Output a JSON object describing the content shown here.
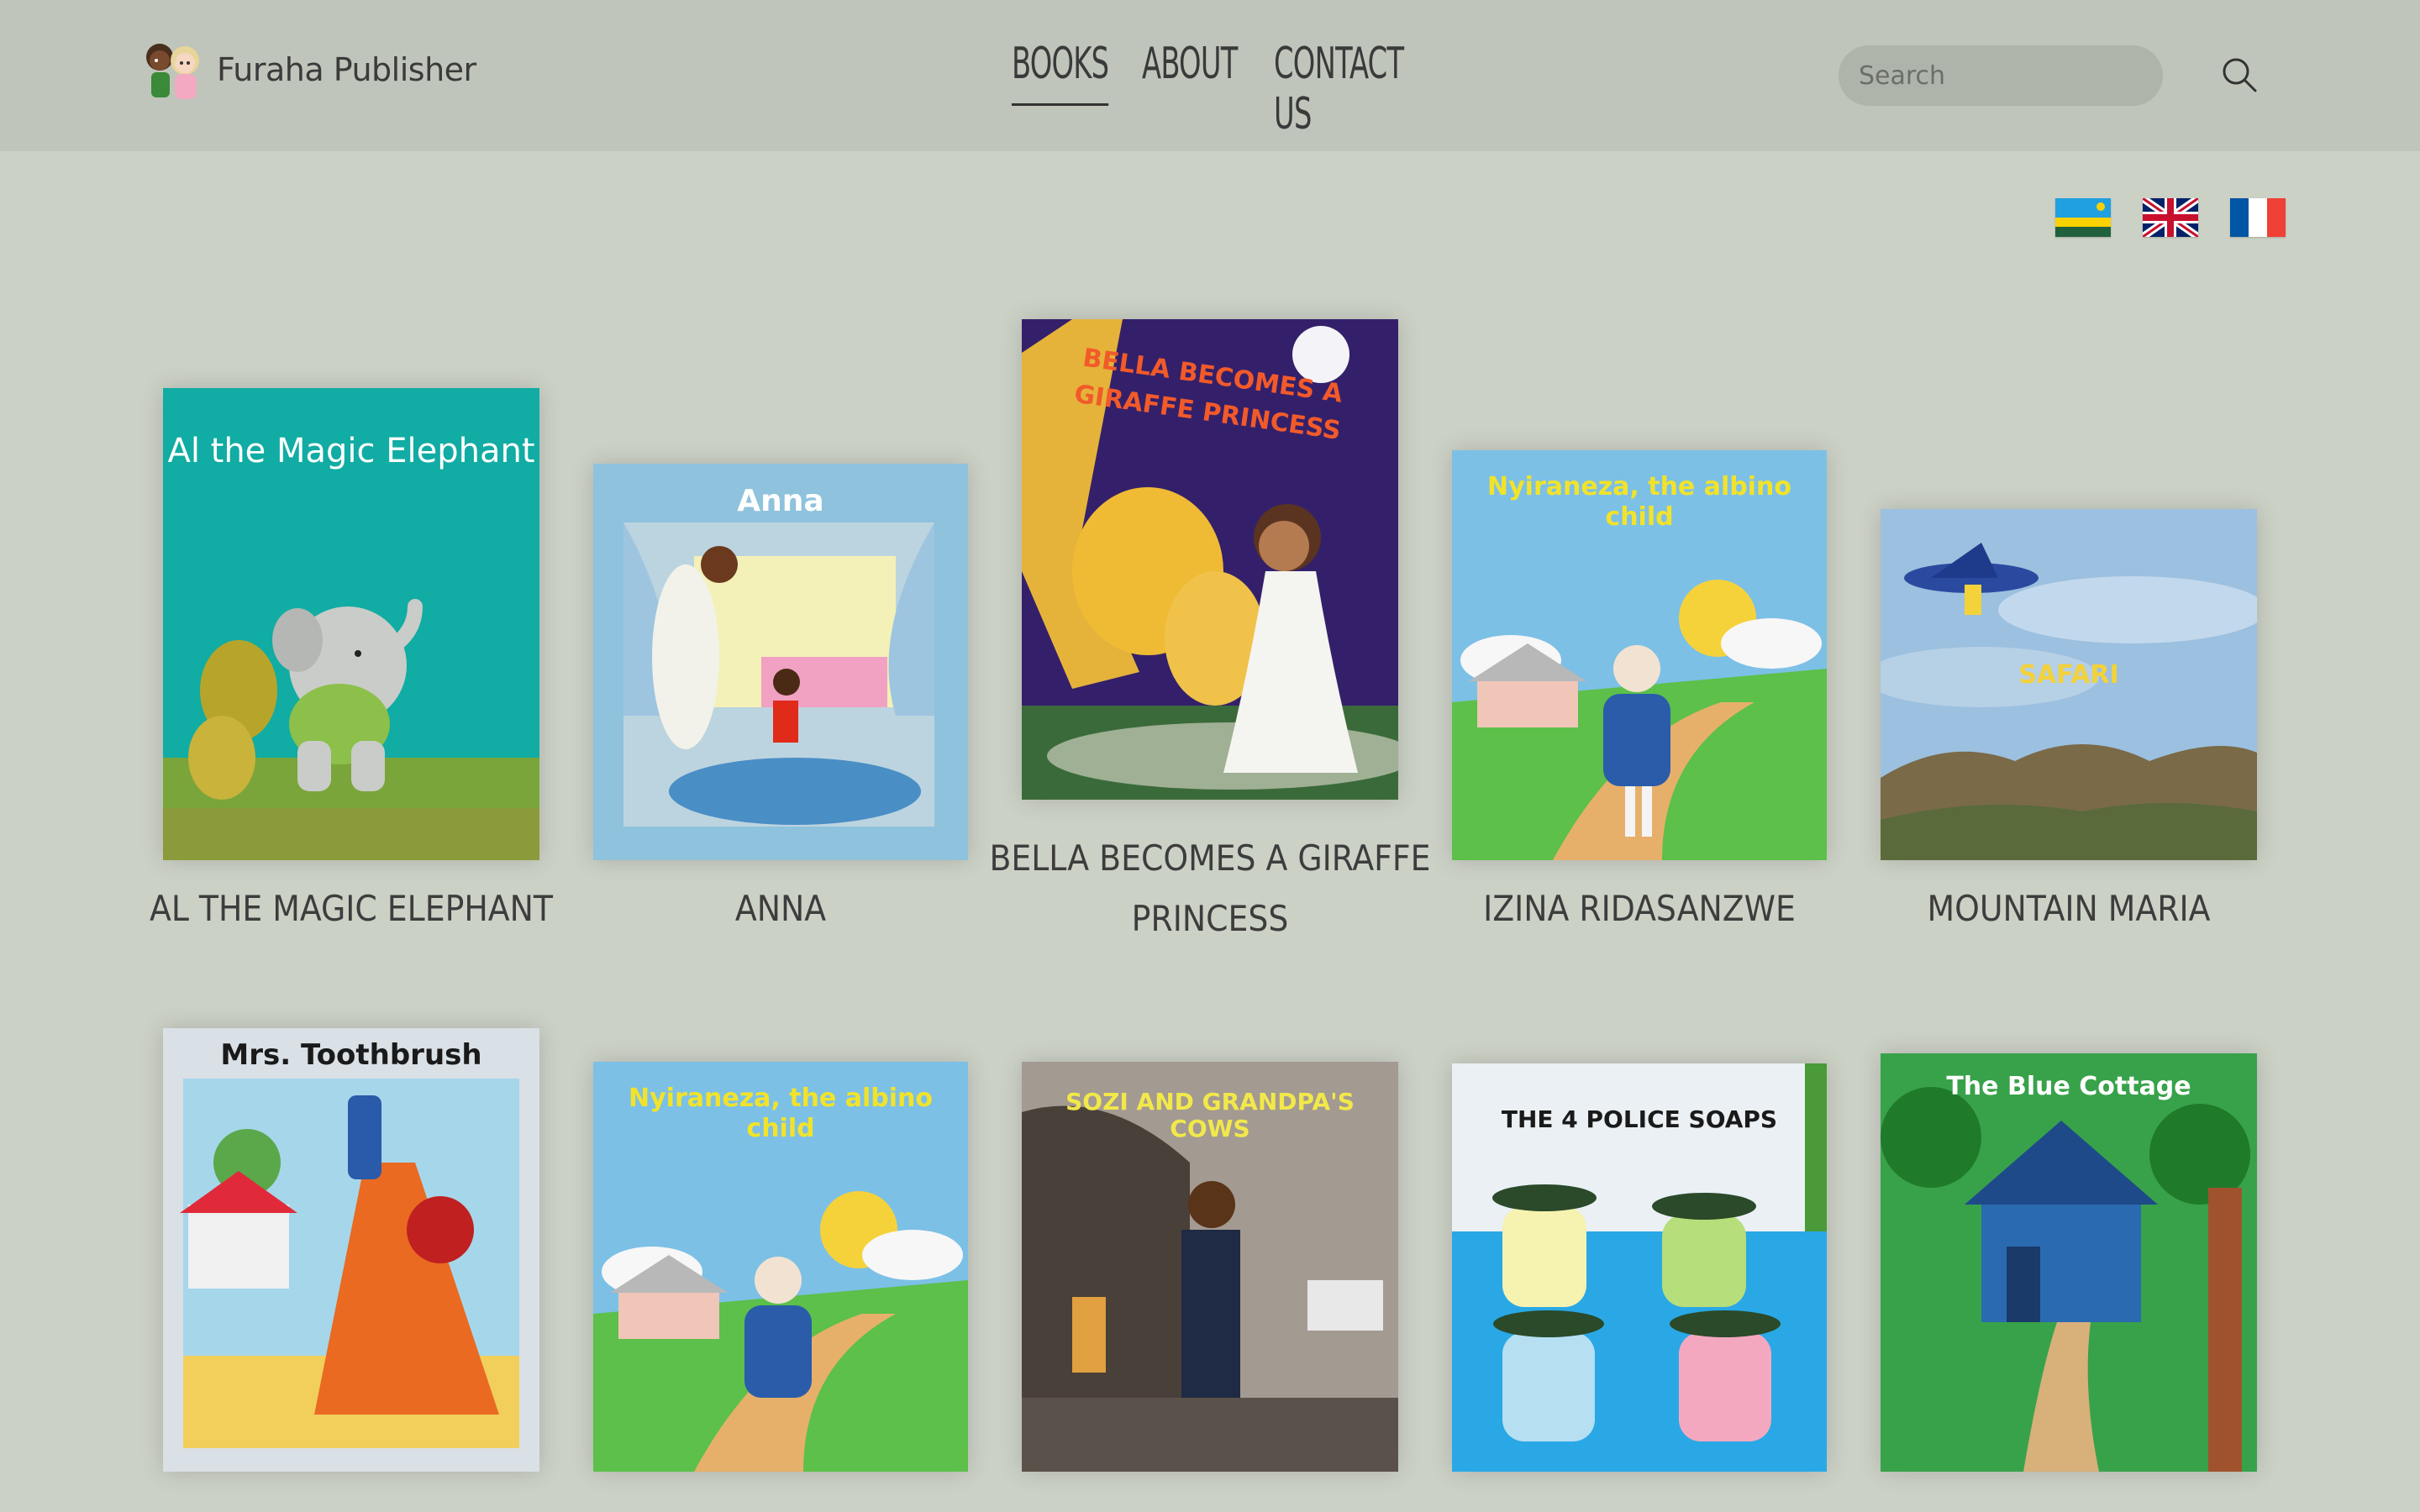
{
  "brand": {
    "name": "Furaha Publisher"
  },
  "nav": {
    "items": [
      "BOOKS",
      "ABOUT",
      "CONTACT US"
    ],
    "active": "BOOKS"
  },
  "search": {
    "placeholder": "Search",
    "value": "",
    "icon": "search-icon"
  },
  "languages": [
    {
      "name": "Rwanda flag",
      "icon": "rwanda-flag-icon"
    },
    {
      "name": "UK flag",
      "icon": "uk-flag-icon"
    },
    {
      "name": "France flag",
      "icon": "france-flag-icon"
    }
  ],
  "books_row1": [
    {
      "title": "AL THE MAGIC ELEPHANT",
      "cover_text": "Al the Magic Elephant"
    },
    {
      "title": "ANNA",
      "cover_text": "Anna"
    },
    {
      "title_line1": "BELLA BECOMES A GIRAFFE",
      "title_line2": "PRINCESS",
      "cover_text": "BELLA BECOMES A GIRAFFE PRINCESS"
    },
    {
      "title": "IZINA RIDASANZWE",
      "cover_text": "Nyiraneza, the albino child"
    },
    {
      "title": "MOUNTAIN MARIA",
      "cover_text": "SAFARI"
    }
  ],
  "books_row2": [
    {
      "cover_text": "Mrs. Toothbrush"
    },
    {
      "cover_text": "Nyiraneza, the albino child"
    },
    {
      "cover_text": "SOZI AND GRANDPA'S COWS"
    },
    {
      "cover_text": "THE 4 POLICE SOAPS"
    },
    {
      "cover_text": "The Blue Cottage"
    }
  ],
  "colors": {
    "page_bg": "#ccd1c6",
    "header_bg": "#bfc5ba",
    "search_bg": "#aeb4aa",
    "text": "#3a3a3a"
  }
}
